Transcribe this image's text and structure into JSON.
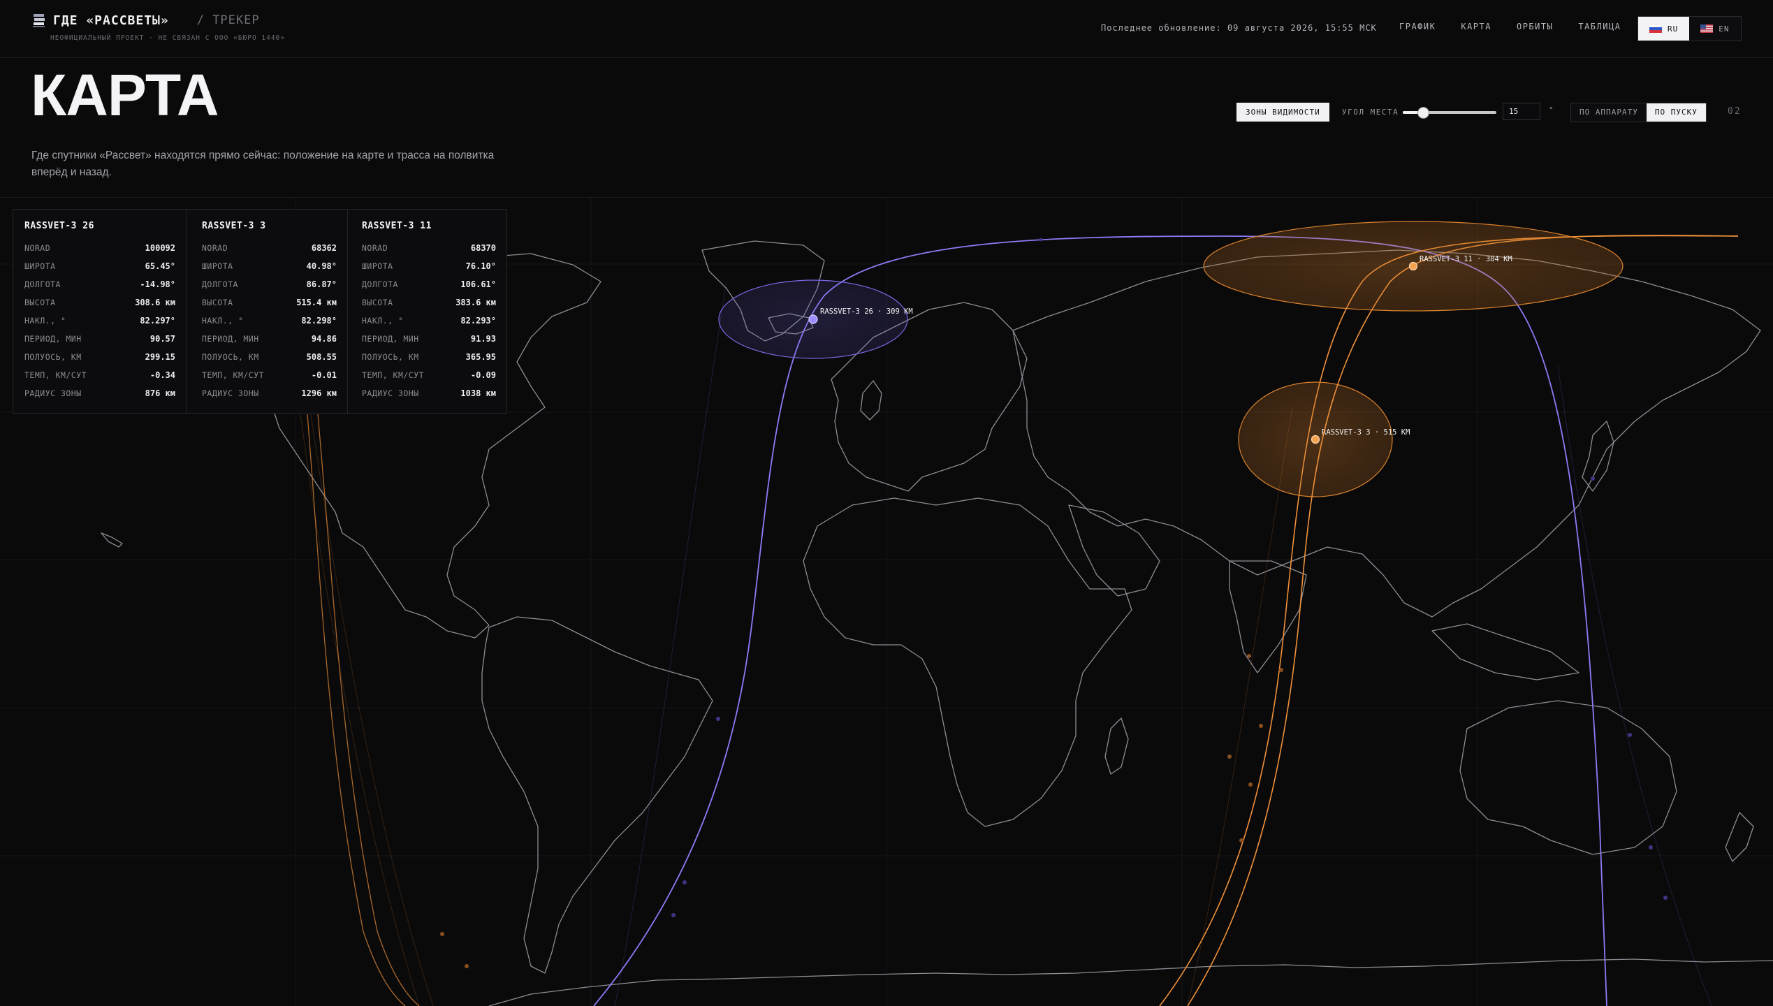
{
  "header": {
    "brand_title": "ГДЕ «РАССВЕТЫ»",
    "brand_section": "/ ТРЕКЕР",
    "brand_subtitle": "НЕОФИЦИАЛЬНЫЙ ПРОЕКТ · НЕ СВЯЗАН С ООО «БЮРО 1440»",
    "last_update": "Последнее обновление: 09 августа 2026, 15:55 МСК",
    "nav": [
      "ГРАФИК",
      "КАРТА",
      "ОРБИТЫ",
      "ТАБЛИЦА"
    ],
    "lang": {
      "ru": "RU",
      "en": "EN",
      "active": "RU"
    }
  },
  "page": {
    "title": "КАРТА",
    "description": "Где спутники «Рассвет» находятся прямо сейчас: положение на карте и трасса на полвитка вперёд и назад.",
    "page_number": "02"
  },
  "controls": {
    "zones_button": "ЗОНЫ ВИДИМОСТИ",
    "elevation_label": "УГОЛ МЕСТА",
    "elevation_value": "15",
    "elevation_slider_fraction": 0.22,
    "elevation_unit": "°",
    "mode_by_satellite": "ПО АППАРАТУ",
    "mode_by_launch": "ПО ПУСКУ",
    "mode_active": "ПО ПУСКУ"
  },
  "satellites": [
    {
      "name": "RASSVET-3 26",
      "map_label": "RASSVET-3 26 · 309 KM",
      "color": "#8b7cf6",
      "rows": [
        {
          "k": "NORAD",
          "v": "100092"
        },
        {
          "k": "ШИРОТА",
          "v": "65.45°"
        },
        {
          "k": "ДОЛГОТА",
          "v": "-14.98°"
        },
        {
          "k": "ВЫСОТА",
          "v": "308.6 км"
        },
        {
          "k": "НАКЛ., °",
          "v": "82.297°"
        },
        {
          "k": "ПЕРИОД, МИН",
          "v": "90.57"
        },
        {
          "k": "ПОЛУОСЬ, КМ",
          "v": "299.15"
        },
        {
          "k": "ТЕМП, КМ/СУТ",
          "v": "-0.34"
        },
        {
          "k": "РАДИУС ЗОНЫ",
          "v": "876 км"
        }
      ]
    },
    {
      "name": "RASSVET-3 3",
      "map_label": "RASSVET-3 3 · 515 KM",
      "color": "#f0913a",
      "rows": [
        {
          "k": "NORAD",
          "v": "68362"
        },
        {
          "k": "ШИРОТА",
          "v": "40.98°"
        },
        {
          "k": "ДОЛГОТА",
          "v": "86.87°"
        },
        {
          "k": "ВЫСОТА",
          "v": "515.4 км"
        },
        {
          "k": "НАКЛ., °",
          "v": "82.298°"
        },
        {
          "k": "ПЕРИОД, МИН",
          "v": "94.86"
        },
        {
          "k": "ПОЛУОСЬ, КМ",
          "v": "508.55"
        },
        {
          "k": "ТЕМП, КМ/СУТ",
          "v": "-0.01"
        },
        {
          "k": "РАДИУС ЗОНЫ",
          "v": "1296 км"
        }
      ]
    },
    {
      "name": "RASSVET-3 11",
      "map_label": "RASSVET-3 11 · 384 KM",
      "color": "#f0913a",
      "rows": [
        {
          "k": "NORAD",
          "v": "68370"
        },
        {
          "k": "ШИРОТА",
          "v": "76.10°"
        },
        {
          "k": "ДОЛГОТА",
          "v": "106.61°"
        },
        {
          "k": "ВЫСОТА",
          "v": "383.6 км"
        },
        {
          "k": "НАКЛ., °",
          "v": "82.293°"
        },
        {
          "k": "ПЕРИОД, МИН",
          "v": "91.93"
        },
        {
          "k": "ПОЛУОСЬ, КМ",
          "v": "365.95"
        },
        {
          "k": "ТЕМП, КМ/СУТ",
          "v": "-0.09"
        },
        {
          "k": "РАДИУС ЗОНЫ",
          "v": "1038 км"
        }
      ]
    }
  ],
  "colors": {
    "background": "#0a0a0b",
    "coastline": "#8d8d95",
    "grid": "#1c1c20",
    "track_violet": "#8b7cf6",
    "track_orange": "#f0913a"
  },
  "icons": {
    "brand": "server-stack-icon",
    "flag_ru": "russia-flag-icon",
    "flag_en": "usa-flag-icon"
  }
}
